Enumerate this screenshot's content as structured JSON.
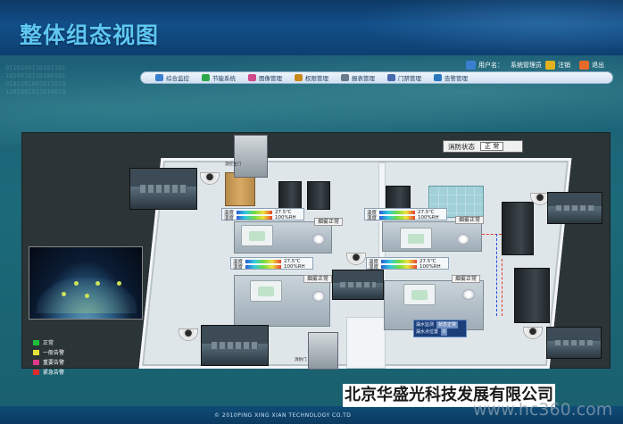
{
  "header": {
    "title": "整体组态视图"
  },
  "userbar": {
    "user_label": "用户名：",
    "user_name": "系统管理员",
    "logout_label": "注销",
    "exit_label": "退出"
  },
  "nav": {
    "items": [
      {
        "label": "综合监控",
        "icon": "monitor-icon",
        "color": "#3a7fd0"
      },
      {
        "label": "节能系统",
        "icon": "energy-icon",
        "color": "#2fa84a"
      },
      {
        "label": "图像管理",
        "icon": "image-icon",
        "color": "#d04a8a"
      },
      {
        "label": "权限管理",
        "icon": "key-icon",
        "color": "#c98a1a"
      },
      {
        "label": "报表管理",
        "icon": "report-icon",
        "color": "#6a7b8c"
      },
      {
        "label": "门禁管理",
        "icon": "door-icon",
        "color": "#4a6ab0"
      },
      {
        "label": "告警管理",
        "icon": "alarm-icon",
        "color": "#2a78c0"
      }
    ]
  },
  "fire": {
    "label": "消防状态",
    "value": "正 常"
  },
  "sensors": [
    {
      "temp_label": "温度",
      "temp_value": "27.5℃",
      "hum_label": "湿度",
      "hum_value": "100%RH"
    },
    {
      "temp_label": "温度",
      "temp_value": "27.5℃",
      "hum_label": "湿度",
      "hum_value": "100%RH"
    },
    {
      "temp_label": "温度",
      "temp_value": "27.5℃",
      "hum_label": "湿度",
      "hum_value": "100%RH"
    },
    {
      "temp_label": "温度",
      "temp_value": "27.5℃",
      "hum_label": "湿度",
      "hum_value": "100%RH"
    }
  ],
  "smoke_alarms": [
    "烟雾正常",
    "烟雾正常",
    "烟雾正常",
    "烟雾正常"
  ],
  "leak": {
    "row1_label": "漏水监测",
    "row1_value": "状态正常",
    "row2_label": "漏水点位置",
    "row2_value": "0"
  },
  "entrances": [
    "温控主门",
    "消防门"
  ],
  "legend": [
    {
      "label": "正常",
      "color": "#1fbf3a"
    },
    {
      "label": "一般告警",
      "color": "#e6e23a"
    },
    {
      "label": "重要告警",
      "color": "#e03a8a"
    },
    {
      "label": "紧急告警",
      "color": "#e02a2a"
    }
  ],
  "footer": {
    "copyright": "© 2010PING XING XIAN TECHNOLOGY CO.TD"
  },
  "overlay": {
    "company": "北京华盛光科技发展有限公司",
    "watermark": "www.hc360.com"
  }
}
